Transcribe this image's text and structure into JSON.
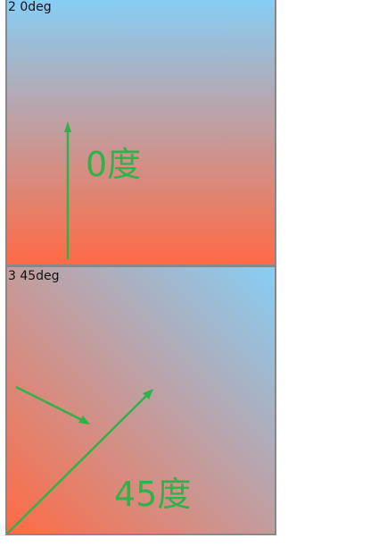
{
  "panels": [
    {
      "caption": "2 0deg",
      "label": "0度",
      "angle": "0deg"
    },
    {
      "caption": "3 45deg",
      "label": "45度",
      "angle": "45deg"
    }
  ],
  "colors": {
    "gradient_start": "#ff6a45",
    "gradient_end": "#87cef5",
    "accent": "#2db34a",
    "border": "#888888"
  }
}
